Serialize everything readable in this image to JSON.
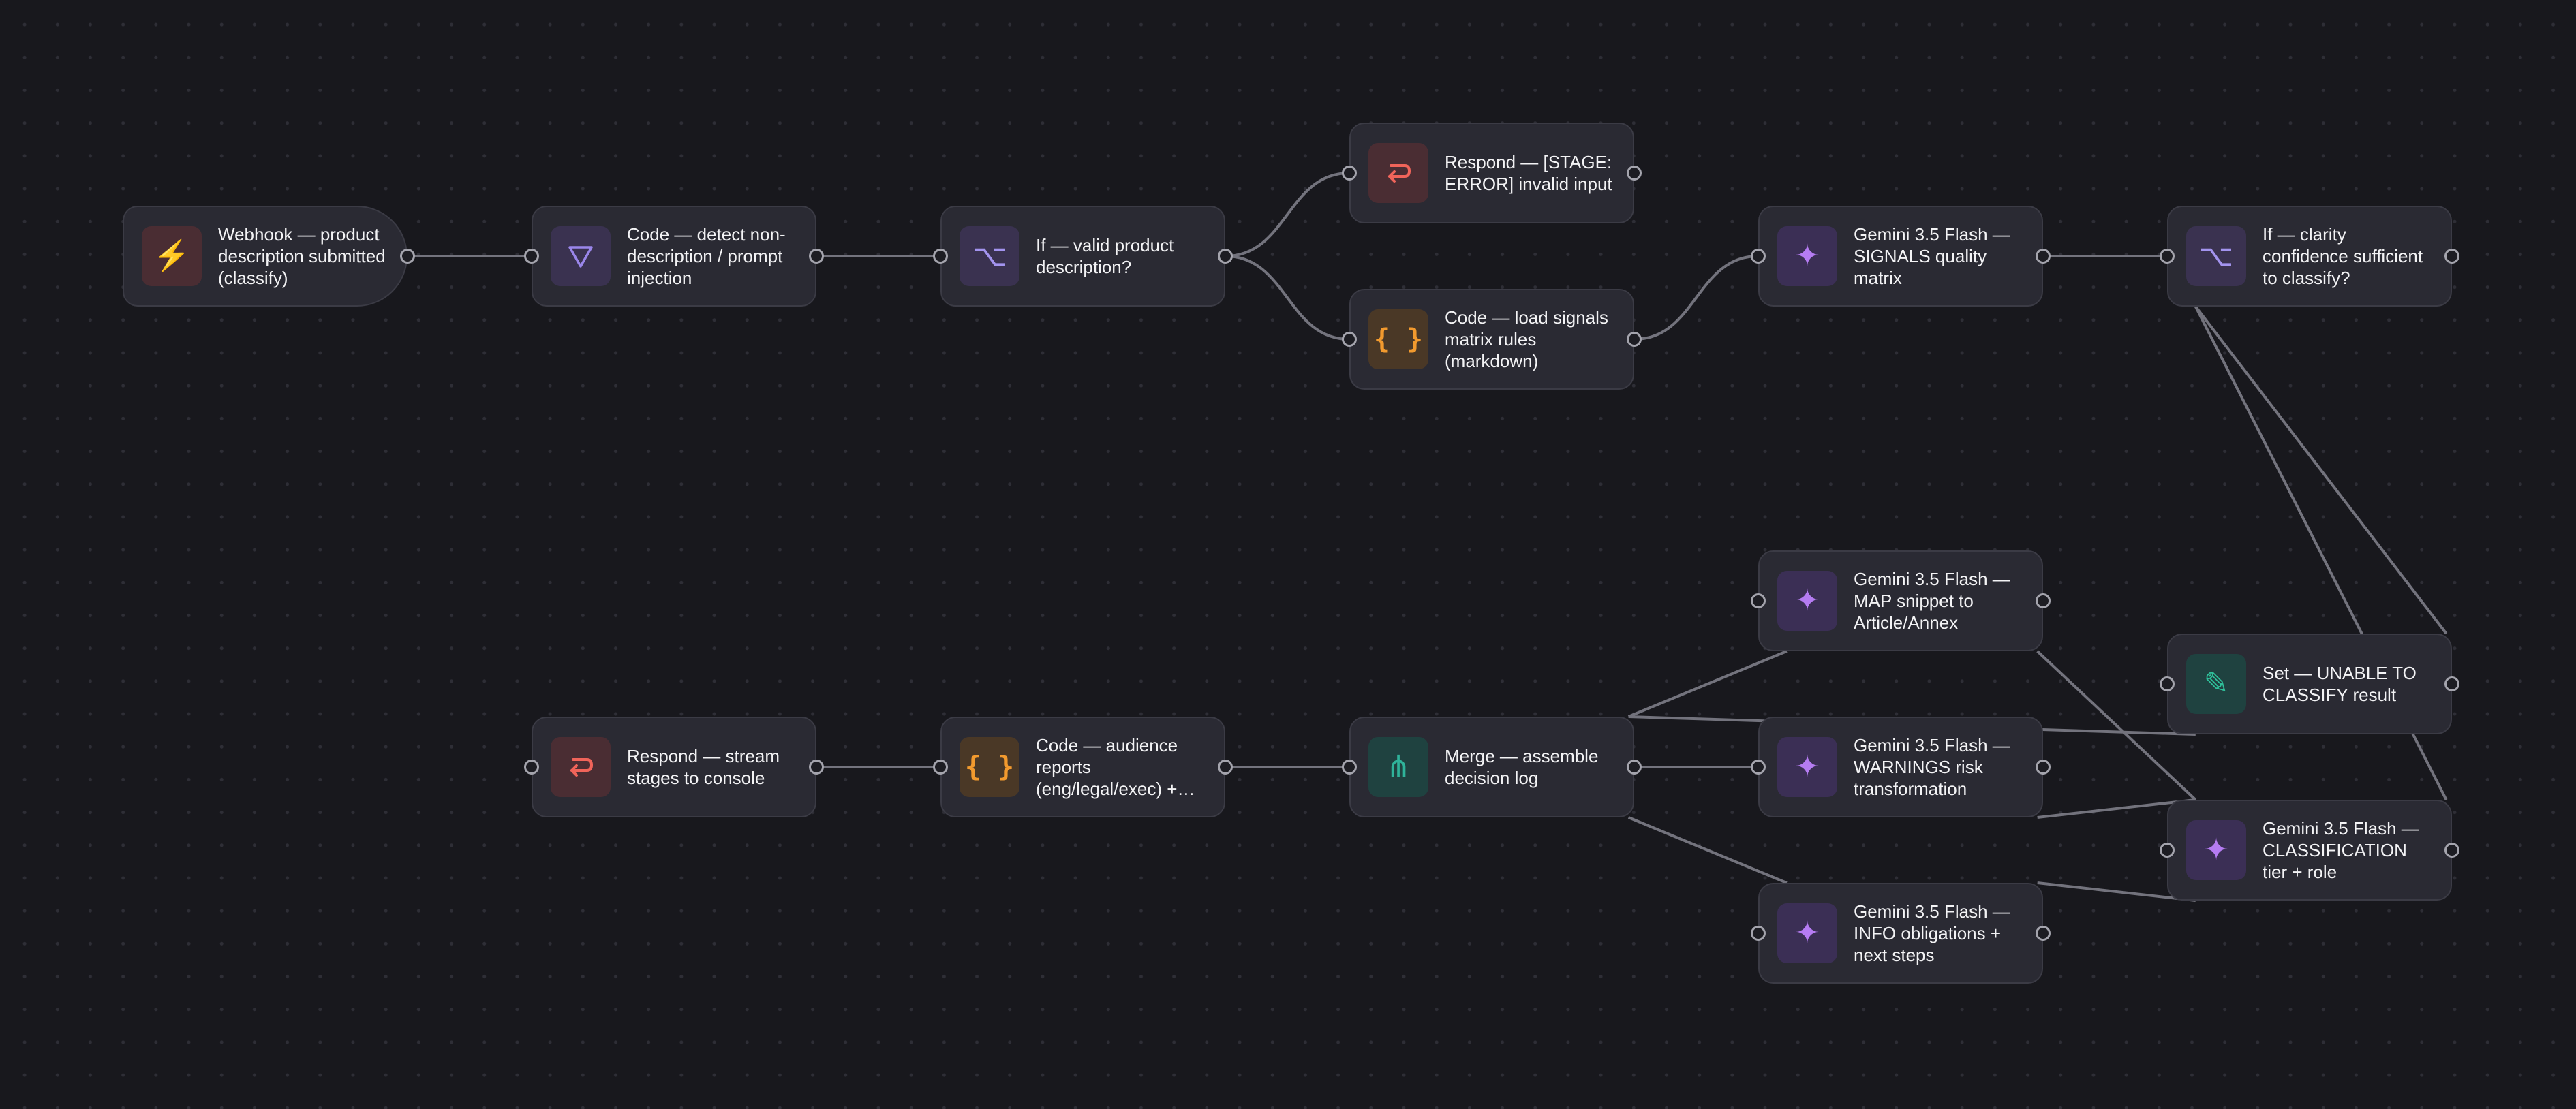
{
  "canvas": {
    "background": "#18181d",
    "grid_dot_color": "#2e2e36",
    "wire_color": "#73737d"
  },
  "node_types": {
    "webhook": {
      "icon": "lightning-icon",
      "color": "#f2c94c"
    },
    "filter": {
      "icon": "funnel-icon",
      "color": "#9a86ea"
    },
    "if": {
      "icon": "branch-icon",
      "color": "#a394ef"
    },
    "respond": {
      "icon": "return-arrow-icon",
      "color": "#f0645a"
    },
    "code": {
      "icon": "braces-icon",
      "color": "#f29a2e"
    },
    "ai": {
      "icon": "sparkle-icon",
      "color": "#b57cf2"
    },
    "merge": {
      "icon": "merge-icon",
      "color": "#2fb39a"
    },
    "set": {
      "icon": "pencil-icon",
      "color": "#2fc09a"
    }
  },
  "nodes": {
    "webhook": {
      "label": "Webhook — product description submitted (classify)"
    },
    "detect": {
      "label": "Code — detect non-description / prompt injection"
    },
    "if_valid": {
      "label": "If — valid product description?"
    },
    "respond_error": {
      "label": "Respond — [STAGE: ERROR] invalid input"
    },
    "load_signals": {
      "label": "Code — load signals matrix rules (markdown)"
    },
    "gemini_signals": {
      "label": "Gemini 3.5 Flash — SIGNALS quality matrix"
    },
    "if_clarity": {
      "label": "If — clarity confidence sufficient to classify?"
    },
    "gemini_map": {
      "label": "Gemini 3.5 Flash — MAP snippet to Article/Annex"
    },
    "set_unable": {
      "label": "Set — UNABLE TO CLASSIFY result"
    },
    "respond_stream": {
      "label": "Respond — stream stages to console"
    },
    "code_reports": {
      "label": "Code — audience reports (eng/legal/exec) + final"
    },
    "merge": {
      "label": "Merge — assemble decision log"
    },
    "gemini_warnings": {
      "label": "Gemini 3.5 Flash — WARNINGS risk transformation"
    },
    "gemini_classification": {
      "label": "Gemini 3.5 Flash — CLASSIFICATION tier + role"
    },
    "gemini_info": {
      "label": "Gemini 3.5 Flash — INFO obligations + next steps"
    }
  },
  "connections": [
    [
      "webhook",
      "detect"
    ],
    [
      "detect",
      "if_valid"
    ],
    [
      "if_valid",
      "respond_error"
    ],
    [
      "if_valid",
      "load_signals"
    ],
    [
      "load_signals",
      "gemini_signals"
    ],
    [
      "gemini_signals",
      "if_clarity"
    ],
    [
      "if_clarity",
      "set_unable"
    ],
    [
      "if_clarity",
      "gemini_classification"
    ],
    [
      "gemini_classification",
      "gemini_map"
    ],
    [
      "gemini_classification",
      "gemini_warnings"
    ],
    [
      "gemini_classification",
      "gemini_info"
    ],
    [
      "gemini_map",
      "merge"
    ],
    [
      "set_unable",
      "merge"
    ],
    [
      "gemini_warnings",
      "merge"
    ],
    [
      "gemini_info",
      "merge"
    ],
    [
      "merge",
      "code_reports"
    ],
    [
      "code_reports",
      "respond_stream"
    ]
  ]
}
